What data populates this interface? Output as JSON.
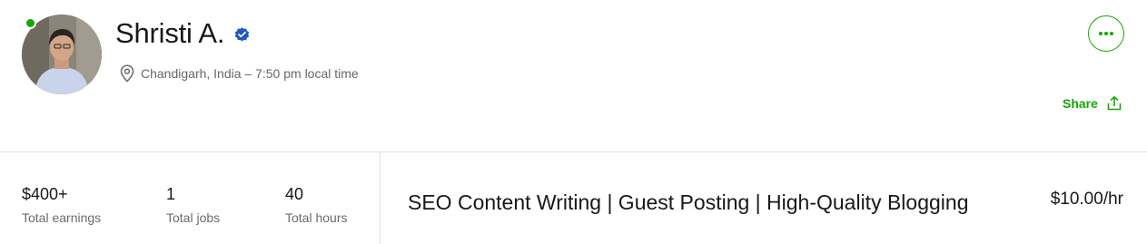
{
  "profile": {
    "name": "Shristi A.",
    "verified": true,
    "online": true,
    "location": "Chandigarh, India – 7:50 pm local time"
  },
  "actions": {
    "share_label": "Share"
  },
  "stats": [
    {
      "value": "$400+",
      "label": "Total earnings"
    },
    {
      "value": "1",
      "label": "Total jobs"
    },
    {
      "value": "40",
      "label": "Total hours"
    }
  ],
  "listing": {
    "title": "SEO Content Writing | Guest Posting | High-Quality Blogging",
    "rate": "$10.00/hr"
  },
  "colors": {
    "brand_green": "#14a800",
    "verified_blue": "#1f57c3",
    "divider": "#e0e0e0"
  },
  "icons": {
    "location": "map-pin-icon",
    "verified": "verified-badge-icon",
    "more": "more-dots-icon",
    "share": "share-upload-icon"
  }
}
